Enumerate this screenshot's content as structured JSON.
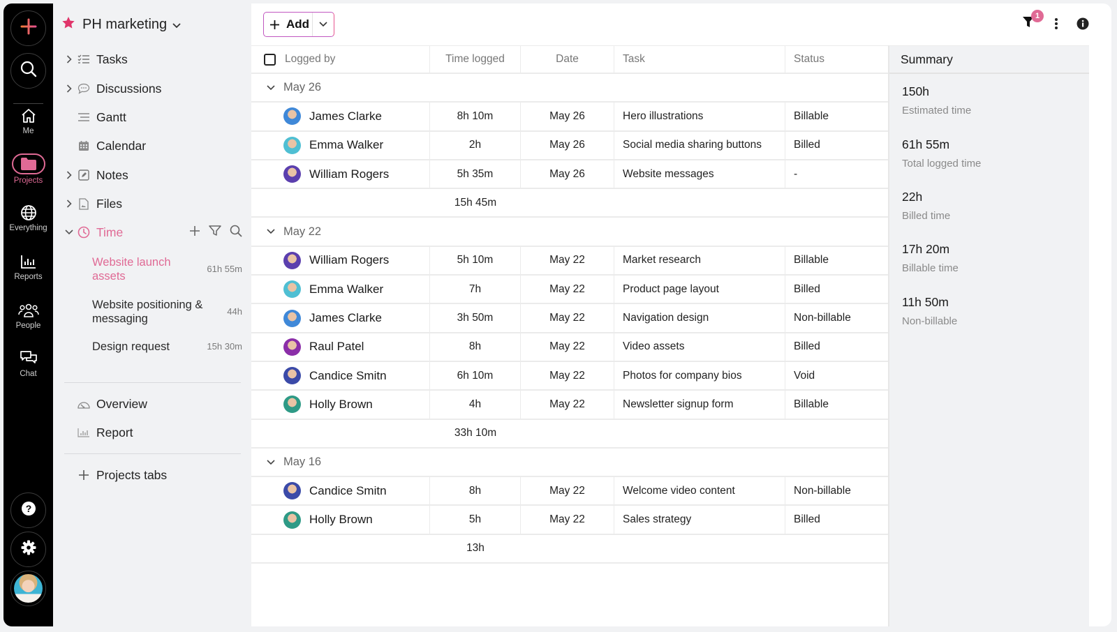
{
  "rail": {
    "items": [
      {
        "label": "Me",
        "icon": "home-icon"
      },
      {
        "label": "Projects",
        "icon": "folder-icon",
        "active": true
      },
      {
        "label": "Everything",
        "icon": "globe-icon"
      },
      {
        "label": "Reports",
        "icon": "bar-chart-icon"
      },
      {
        "label": "People",
        "icon": "people-icon"
      },
      {
        "label": "Chat",
        "icon": "chat-icon"
      }
    ],
    "accent": "#e06a95"
  },
  "project": {
    "title": "PH marketing",
    "nav": [
      {
        "label": "Tasks"
      },
      {
        "label": "Discussions"
      },
      {
        "label": "Gantt"
      },
      {
        "label": "Calendar"
      },
      {
        "label": "Notes"
      },
      {
        "label": "Files"
      },
      {
        "label": "Time"
      }
    ],
    "time_sheets": [
      {
        "label": "Website launch assets",
        "value": "61h 55m",
        "active": true
      },
      {
        "label": "Website positioning & messaging",
        "value": "44h"
      },
      {
        "label": "Design request",
        "value": "15h 30m"
      }
    ],
    "extra": [
      {
        "label": "Overview"
      },
      {
        "label": "Report"
      }
    ],
    "projects_tabs_label": "Projects tabs"
  },
  "toolbar": {
    "add_label": "Add",
    "filter_count": "1"
  },
  "table": {
    "headers": {
      "logged_by": "Logged by",
      "time_logged": "Time logged",
      "date": "Date",
      "task": "Task",
      "status": "Status"
    },
    "groups": [
      {
        "date": "May 26",
        "rows": [
          {
            "name": "James Clarke",
            "time": "8h 10m",
            "date": "May 26",
            "task": "Hero illustrations",
            "status": "Billable",
            "avatar": "#3f88d8"
          },
          {
            "name": "Emma Walker",
            "time": "2h",
            "date": "May 26",
            "task": "Social media sharing buttons",
            "status": "Billed",
            "avatar": "#4fbfd3"
          },
          {
            "name": "William Rogers",
            "time": "5h 35m",
            "date": "May 26",
            "task": "Website messages",
            "status": "-",
            "avatar": "#5b3fae"
          }
        ],
        "total": "15h 45m"
      },
      {
        "date": "May 22",
        "rows": [
          {
            "name": "William Rogers",
            "time": "5h 10m",
            "date": "May 22",
            "task": "Market research",
            "status": "Billable",
            "avatar": "#5b3fae"
          },
          {
            "name": "Emma Walker",
            "time": "7h",
            "date": "May 22",
            "task": "Product page layout",
            "status": "Billed",
            "avatar": "#4fbfd3"
          },
          {
            "name": "James Clarke",
            "time": "3h 50m",
            "date": "May 22",
            "task": "Navigation design",
            "status": "Non-billable",
            "avatar": "#3f88d8"
          },
          {
            "name": "Raul Patel",
            "time": "8h",
            "date": "May 22",
            "task": "Video assets",
            "status": "Billed",
            "avatar": "#8b2ea8"
          },
          {
            "name": "Candice Smitn",
            "time": "6h 10m",
            "date": "May 22",
            "task": "Photos for company bios",
            "status": "Void",
            "avatar": "#3b4aa8"
          },
          {
            "name": "Holly Brown",
            "time": "4h",
            "date": "May 22",
            "task": "Newsletter signup form",
            "status": "Billable",
            "avatar": "#2e9a86"
          }
        ],
        "total": "33h 10m"
      },
      {
        "date": "May 16",
        "rows": [
          {
            "name": "Candice Smitn",
            "time": "8h",
            "date": "May 22",
            "task": "Welcome video content",
            "status": "Non-billable",
            "avatar": "#3b4aa8"
          },
          {
            "name": "Holly Brown",
            "time": "5h",
            "date": "May 22",
            "task": "Sales strategy",
            "status": "Billed",
            "avatar": "#2e9a86"
          }
        ],
        "total": "13h"
      }
    ]
  },
  "summary": {
    "title": "Summary",
    "items": [
      {
        "value": "150h",
        "label": "Estimated time"
      },
      {
        "value": "61h 55m",
        "label": "Total logged time"
      },
      {
        "value": "22h",
        "label": "Billed time"
      },
      {
        "value": "17h 20m",
        "label": "Billable time"
      },
      {
        "value": "11h 50m",
        "label": "Non-billable"
      }
    ]
  }
}
